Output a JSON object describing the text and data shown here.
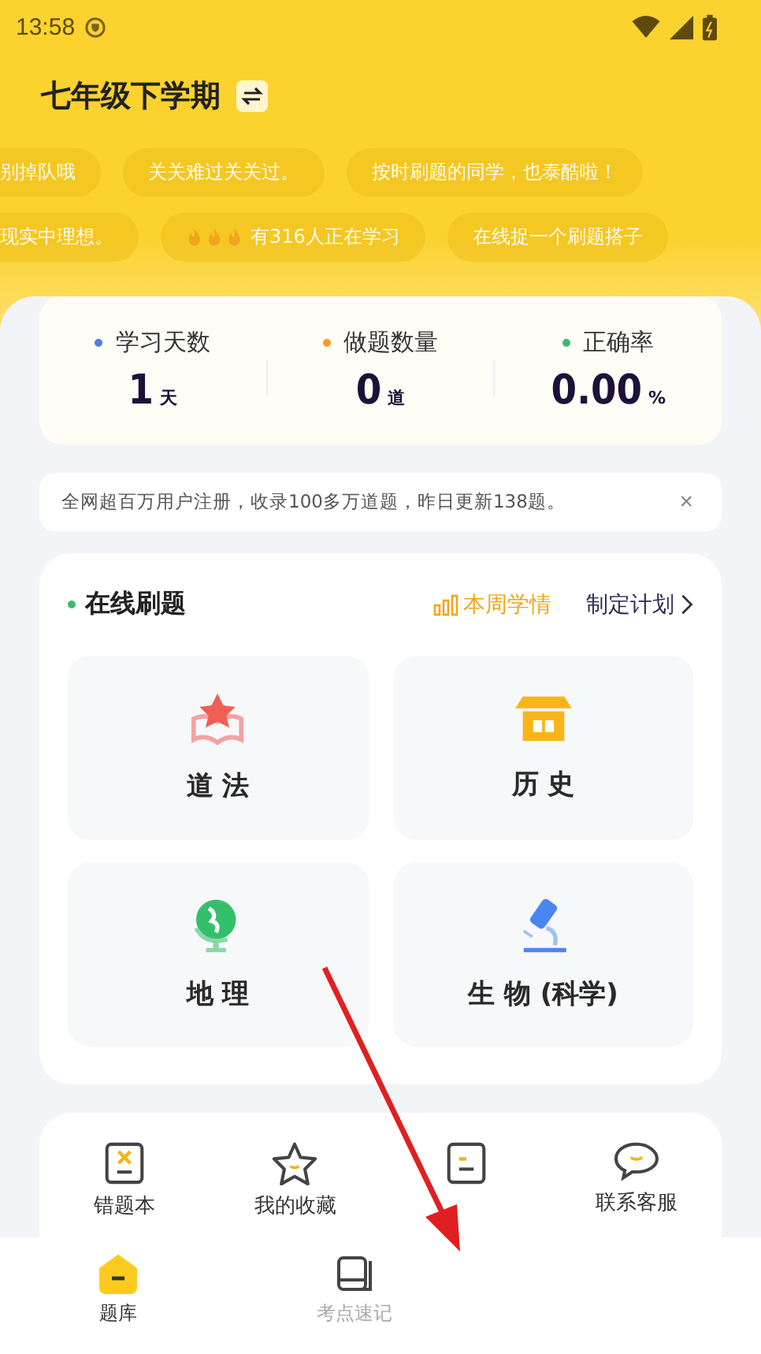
{
  "status_bar": {
    "time": "13:58"
  },
  "header": {
    "title": "七年级下学期"
  },
  "ticker_rows": [
    {
      "chips": [
        {
          "text": "别掉队哦"
        },
        {
          "text": "关关难过关关过。"
        },
        {
          "text": "按时刷题的同学，也泰酷啦！"
        }
      ]
    },
    {
      "chips": [
        {
          "text": "现实中理想。"
        },
        {
          "text": "有316人正在学习",
          "kind": "fire"
        },
        {
          "text": "在线捉一个刷题搭子"
        }
      ]
    }
  ],
  "stats": [
    {
      "label": "学习天数",
      "value": "1",
      "unit": "天",
      "color": "#4a7ee8"
    },
    {
      "label": "做题数量",
      "value": "0",
      "unit": "道",
      "color": "#f0a020"
    },
    {
      "label": "正确率",
      "value": "0.00",
      "unit": "%",
      "color": "#3fb96b"
    }
  ],
  "notice": {
    "text": "全网超百万用户注册，收录100多万道题，昨日更新138题。",
    "close": "×"
  },
  "practice": {
    "title": "在线刷题",
    "weekly": "本周学情",
    "plan": "制定计划",
    "subjects": [
      {
        "name": "道 法",
        "kind": "law"
      },
      {
        "name": "历 史",
        "kind": "history"
      },
      {
        "name": "地 理",
        "kind": "geo"
      },
      {
        "name": "生 物 (科学)",
        "kind": "bio"
      }
    ]
  },
  "tools": [
    {
      "label": "错题本",
      "kind": "wrong"
    },
    {
      "label": "我的收藏",
      "kind": "star"
    },
    {
      "kind": "note"
    },
    {
      "label": "联系客服",
      "kind": "chat"
    }
  ],
  "tabs": [
    {
      "label": "题库",
      "selected": true
    },
    {
      "label": "考点速记",
      "selected": false
    }
  ]
}
